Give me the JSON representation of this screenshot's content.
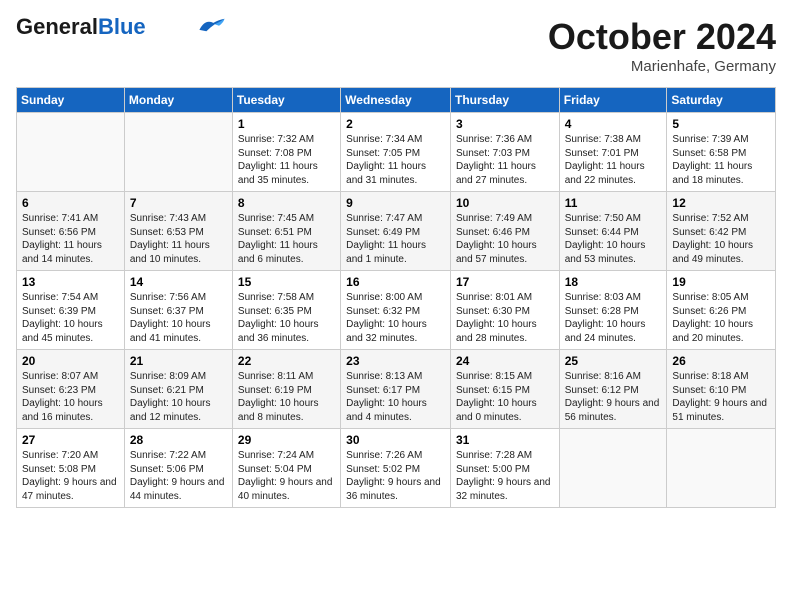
{
  "header": {
    "logo_general": "General",
    "logo_blue": "Blue",
    "month": "October 2024",
    "location": "Marienhafe, Germany"
  },
  "days_of_week": [
    "Sunday",
    "Monday",
    "Tuesday",
    "Wednesday",
    "Thursday",
    "Friday",
    "Saturday"
  ],
  "weeks": [
    [
      {
        "num": "",
        "sunrise": "",
        "sunset": "",
        "daylight": ""
      },
      {
        "num": "",
        "sunrise": "",
        "sunset": "",
        "daylight": ""
      },
      {
        "num": "1",
        "sunrise": "Sunrise: 7:32 AM",
        "sunset": "Sunset: 7:08 PM",
        "daylight": "Daylight: 11 hours and 35 minutes."
      },
      {
        "num": "2",
        "sunrise": "Sunrise: 7:34 AM",
        "sunset": "Sunset: 7:05 PM",
        "daylight": "Daylight: 11 hours and 31 minutes."
      },
      {
        "num": "3",
        "sunrise": "Sunrise: 7:36 AM",
        "sunset": "Sunset: 7:03 PM",
        "daylight": "Daylight: 11 hours and 27 minutes."
      },
      {
        "num": "4",
        "sunrise": "Sunrise: 7:38 AM",
        "sunset": "Sunset: 7:01 PM",
        "daylight": "Daylight: 11 hours and 22 minutes."
      },
      {
        "num": "5",
        "sunrise": "Sunrise: 7:39 AM",
        "sunset": "Sunset: 6:58 PM",
        "daylight": "Daylight: 11 hours and 18 minutes."
      }
    ],
    [
      {
        "num": "6",
        "sunrise": "Sunrise: 7:41 AM",
        "sunset": "Sunset: 6:56 PM",
        "daylight": "Daylight: 11 hours and 14 minutes."
      },
      {
        "num": "7",
        "sunrise": "Sunrise: 7:43 AM",
        "sunset": "Sunset: 6:53 PM",
        "daylight": "Daylight: 11 hours and 10 minutes."
      },
      {
        "num": "8",
        "sunrise": "Sunrise: 7:45 AM",
        "sunset": "Sunset: 6:51 PM",
        "daylight": "Daylight: 11 hours and 6 minutes."
      },
      {
        "num": "9",
        "sunrise": "Sunrise: 7:47 AM",
        "sunset": "Sunset: 6:49 PM",
        "daylight": "Daylight: 11 hours and 1 minute."
      },
      {
        "num": "10",
        "sunrise": "Sunrise: 7:49 AM",
        "sunset": "Sunset: 6:46 PM",
        "daylight": "Daylight: 10 hours and 57 minutes."
      },
      {
        "num": "11",
        "sunrise": "Sunrise: 7:50 AM",
        "sunset": "Sunset: 6:44 PM",
        "daylight": "Daylight: 10 hours and 53 minutes."
      },
      {
        "num": "12",
        "sunrise": "Sunrise: 7:52 AM",
        "sunset": "Sunset: 6:42 PM",
        "daylight": "Daylight: 10 hours and 49 minutes."
      }
    ],
    [
      {
        "num": "13",
        "sunrise": "Sunrise: 7:54 AM",
        "sunset": "Sunset: 6:39 PM",
        "daylight": "Daylight: 10 hours and 45 minutes."
      },
      {
        "num": "14",
        "sunrise": "Sunrise: 7:56 AM",
        "sunset": "Sunset: 6:37 PM",
        "daylight": "Daylight: 10 hours and 41 minutes."
      },
      {
        "num": "15",
        "sunrise": "Sunrise: 7:58 AM",
        "sunset": "Sunset: 6:35 PM",
        "daylight": "Daylight: 10 hours and 36 minutes."
      },
      {
        "num": "16",
        "sunrise": "Sunrise: 8:00 AM",
        "sunset": "Sunset: 6:32 PM",
        "daylight": "Daylight: 10 hours and 32 minutes."
      },
      {
        "num": "17",
        "sunrise": "Sunrise: 8:01 AM",
        "sunset": "Sunset: 6:30 PM",
        "daylight": "Daylight: 10 hours and 28 minutes."
      },
      {
        "num": "18",
        "sunrise": "Sunrise: 8:03 AM",
        "sunset": "Sunset: 6:28 PM",
        "daylight": "Daylight: 10 hours and 24 minutes."
      },
      {
        "num": "19",
        "sunrise": "Sunrise: 8:05 AM",
        "sunset": "Sunset: 6:26 PM",
        "daylight": "Daylight: 10 hours and 20 minutes."
      }
    ],
    [
      {
        "num": "20",
        "sunrise": "Sunrise: 8:07 AM",
        "sunset": "Sunset: 6:23 PM",
        "daylight": "Daylight: 10 hours and 16 minutes."
      },
      {
        "num": "21",
        "sunrise": "Sunrise: 8:09 AM",
        "sunset": "Sunset: 6:21 PM",
        "daylight": "Daylight: 10 hours and 12 minutes."
      },
      {
        "num": "22",
        "sunrise": "Sunrise: 8:11 AM",
        "sunset": "Sunset: 6:19 PM",
        "daylight": "Daylight: 10 hours and 8 minutes."
      },
      {
        "num": "23",
        "sunrise": "Sunrise: 8:13 AM",
        "sunset": "Sunset: 6:17 PM",
        "daylight": "Daylight: 10 hours and 4 minutes."
      },
      {
        "num": "24",
        "sunrise": "Sunrise: 8:15 AM",
        "sunset": "Sunset: 6:15 PM",
        "daylight": "Daylight: 10 hours and 0 minutes."
      },
      {
        "num": "25",
        "sunrise": "Sunrise: 8:16 AM",
        "sunset": "Sunset: 6:12 PM",
        "daylight": "Daylight: 9 hours and 56 minutes."
      },
      {
        "num": "26",
        "sunrise": "Sunrise: 8:18 AM",
        "sunset": "Sunset: 6:10 PM",
        "daylight": "Daylight: 9 hours and 51 minutes."
      }
    ],
    [
      {
        "num": "27",
        "sunrise": "Sunrise: 7:20 AM",
        "sunset": "Sunset: 5:08 PM",
        "daylight": "Daylight: 9 hours and 47 minutes."
      },
      {
        "num": "28",
        "sunrise": "Sunrise: 7:22 AM",
        "sunset": "Sunset: 5:06 PM",
        "daylight": "Daylight: 9 hours and 44 minutes."
      },
      {
        "num": "29",
        "sunrise": "Sunrise: 7:24 AM",
        "sunset": "Sunset: 5:04 PM",
        "daylight": "Daylight: 9 hours and 40 minutes."
      },
      {
        "num": "30",
        "sunrise": "Sunrise: 7:26 AM",
        "sunset": "Sunset: 5:02 PM",
        "daylight": "Daylight: 9 hours and 36 minutes."
      },
      {
        "num": "31",
        "sunrise": "Sunrise: 7:28 AM",
        "sunset": "Sunset: 5:00 PM",
        "daylight": "Daylight: 9 hours and 32 minutes."
      },
      {
        "num": "",
        "sunrise": "",
        "sunset": "",
        "daylight": ""
      },
      {
        "num": "",
        "sunrise": "",
        "sunset": "",
        "daylight": ""
      }
    ]
  ]
}
